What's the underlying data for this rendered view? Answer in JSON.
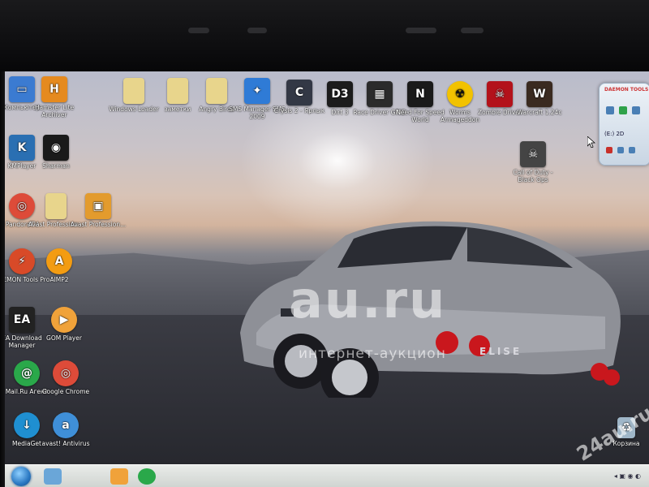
{
  "screen": {
    "desktop_icons": [
      {
        "label": "Компьютер",
        "icon": "computer-icon",
        "color": "#3b7bd1"
      },
      {
        "label": "Hamster Lite Archiver",
        "icon": "hamster-archiver-icon",
        "color": "#e58a1f"
      },
      {
        "label": "Windows Loader",
        "icon": "folder-icon",
        "color": "#e8d58c"
      },
      {
        "label": "заметки",
        "icon": "folder-icon",
        "color": "#e8d58c"
      },
      {
        "label": "Angry Birds",
        "icon": "folder-icon",
        "color": "#e8d58c"
      },
      {
        "label": "SMS Manager SMS 2009",
        "icon": "sms-manager-icon",
        "color": "#2f7bd6"
      },
      {
        "label": "Crysis 2 - Ярлык",
        "icon": "crysis-icon",
        "color": "#333845"
      },
      {
        "label": "Dirt 3",
        "icon": "dirt3-icon",
        "color": "#1c1c1c"
      },
      {
        "label": "Race Driver GRID",
        "icon": "grid-icon",
        "color": "#2b2b2b"
      },
      {
        "label": "Need For Speed World",
        "icon": "nfs-icon",
        "color": "#1a1a1a"
      },
      {
        "label": "Worms Armageddon",
        "icon": "radiation-icon",
        "color": "#f2c200"
      },
      {
        "label": "Zombie Driver",
        "icon": "zombie-icon",
        "color": "#b3121b"
      },
      {
        "label": "Warcraft 1.24c",
        "icon": "warcraft-icon",
        "color": "#3a2a20"
      },
      {
        "label": "KMPlayer",
        "icon": "kmplayer-icon",
        "color": "#2a6fb2"
      },
      {
        "label": "Sharman",
        "icon": "sharman-icon",
        "color": "#1a1a1a"
      },
      {
        "label": "Call of Duty - Black Ops",
        "icon": "skull-icon",
        "color": "#444"
      },
      {
        "label": "PandoraTV",
        "icon": "chrome-icon",
        "color": "#dd4b39"
      },
      {
        "label": "Avast Profession...",
        "icon": "folder-icon",
        "color": "#e8d58c"
      },
      {
        "label": "Avast Profession...",
        "icon": "package-icon",
        "color": "#e39b2d"
      },
      {
        "label": "DAEMON Tools Pro",
        "icon": "daemon-tools-icon",
        "color": "#d84a28"
      },
      {
        "label": "AIMP2",
        "icon": "aimp-icon",
        "color": "#f39c12"
      },
      {
        "label": "EA Download Manager",
        "icon": "ea-icon",
        "color": "#222"
      },
      {
        "label": "GOM Player",
        "icon": "gom-icon",
        "color": "#f0a23a"
      },
      {
        "label": "Mail.Ru Агент",
        "icon": "mailru-agent-icon",
        "color": "#2aa84a"
      },
      {
        "label": "Google Chrome",
        "icon": "chrome-icon",
        "color": "#dd4b39"
      },
      {
        "label": "MediaGet",
        "icon": "mediaget-icon",
        "color": "#1f8fd1"
      },
      {
        "label": "avast! Antivirus",
        "icon": "avast-icon",
        "color": "#3f8fd8"
      },
      {
        "label": "Корзина",
        "icon": "recycle-bin-icon",
        "color": "#9fb6c8"
      }
    ],
    "gadget": {
      "title": "DAEMON TOOLS",
      "drive": "(E:) 2D"
    },
    "car_badge": "ELISE",
    "watermark": {
      "main": "au.ru",
      "sub": "интернет-аукцион",
      "corner": "24au.ru"
    }
  }
}
